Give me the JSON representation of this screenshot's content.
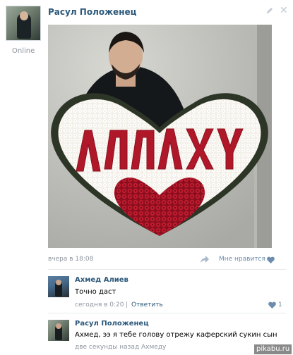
{
  "post": {
    "author": "Расул Положенец",
    "status": "Online",
    "time": "вчера в 18:08",
    "likes_label": "Мне нравится",
    "photo_text": "АЛЛАХУ"
  },
  "comments": [
    {
      "author": "Ахмед Алиев",
      "text": "Точно даст",
      "time": "сегодня в 0:20",
      "separator": "|",
      "reply_label": "Ответить",
      "likes": "1"
    },
    {
      "author": "Расул Положенец",
      "text": "Ахмед, ээ я тебе голову отрежу каферский сукин сын",
      "time": "две секунды назад Ахмеду"
    }
  ],
  "watermark": "pikabu.ru",
  "colors": {
    "link": "#2b587a",
    "meta": "#8d959e",
    "heart": "#6b8cad",
    "roses": "#b0182a"
  },
  "icons": [
    "pencil-icon",
    "close-icon",
    "share-icon",
    "heart-icon"
  ]
}
